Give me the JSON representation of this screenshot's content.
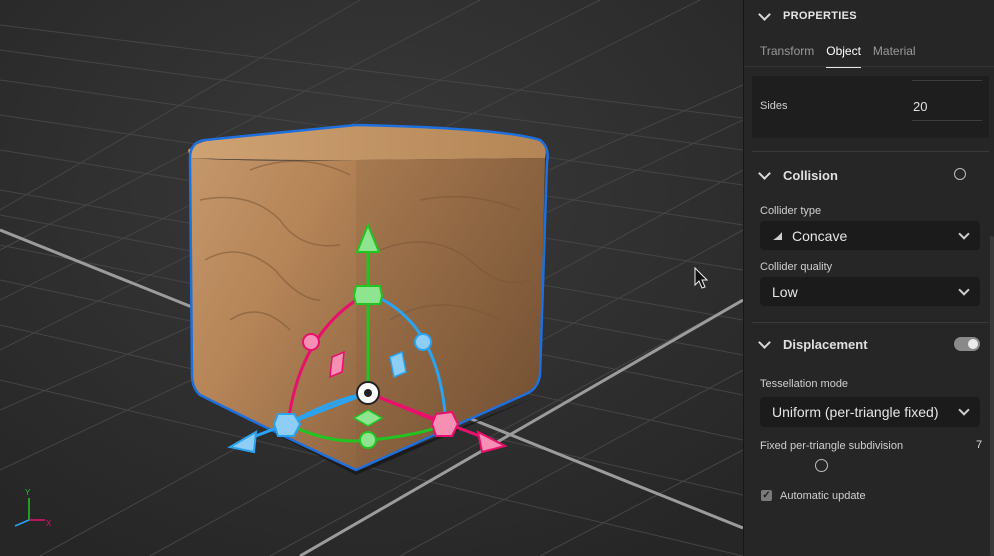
{
  "properties": {
    "title": "PROPERTIES",
    "tabs": [
      {
        "label": "Transform",
        "active": false
      },
      {
        "label": "Object",
        "active": true
      },
      {
        "label": "Material",
        "active": false
      }
    ],
    "sides": {
      "label": "Sides",
      "value": "20"
    }
  },
  "collision": {
    "title": "Collision",
    "collider_type": {
      "label": "Collider type",
      "value": "Concave",
      "icon": "concave-shape-icon"
    },
    "collider_quality": {
      "label": "Collider quality",
      "value": "Low"
    }
  },
  "displacement": {
    "title": "Displacement",
    "enabled": true,
    "tessellation_mode": {
      "label": "Tessellation mode",
      "value": "Uniform (per-triangle fixed)"
    },
    "subdivision": {
      "label": "Fixed per-triangle subdivision",
      "value": "7"
    },
    "automatic_update": {
      "label": "Automatic update",
      "checked": true
    }
  },
  "viewport": {
    "axis_labels": {
      "y": "Y",
      "x": "X"
    },
    "colors": {
      "background": "#2e2e2e",
      "x_axis": "#e8106a",
      "y_axis": "#22c422",
      "z_axis": "#2aa3f0",
      "selection": "#1f6fdc"
    }
  }
}
